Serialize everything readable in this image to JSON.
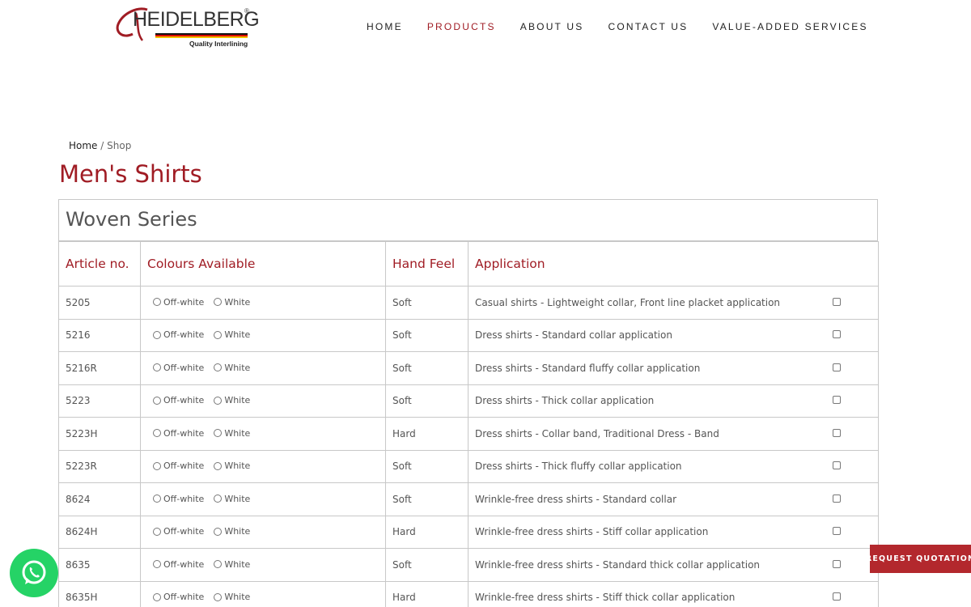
{
  "header": {
    "logo": {
      "name": "HEIDELBERG",
      "tagline": "Quality Interlining"
    },
    "nav": [
      {
        "label": "HOME"
      },
      {
        "label": "PRODUCTS"
      },
      {
        "label": "ABOUT US"
      },
      {
        "label": "CONTACT US"
      },
      {
        "label": "VALUE-ADDED SERVICES"
      }
    ],
    "active_nav": "PRODUCTS"
  },
  "breadcrumb": {
    "home": "Home",
    "separator": "/",
    "current": "Shop"
  },
  "page_title": "Men's Shirts",
  "series_title": "Woven Series",
  "table": {
    "columns": [
      "Article no.",
      "Colours Available",
      "Hand Feel",
      "Application"
    ],
    "colour_options": [
      "Off-white",
      "White"
    ],
    "rows": [
      {
        "article": "5205",
        "hand_feel": "Soft",
        "application": "Casual shirts - Lightweight collar, Front line placket application"
      },
      {
        "article": "5216",
        "hand_feel": "Soft",
        "application": "Dress shirts - Standard collar application"
      },
      {
        "article": "5216R",
        "hand_feel": "Soft",
        "application": "Dress shirts - Standard fluffy collar application"
      },
      {
        "article": "5223",
        "hand_feel": "Soft",
        "application": "Dress shirts - Thick collar application"
      },
      {
        "article": "5223H",
        "hand_feel": "Hard",
        "application": "Dress shirts - Collar band, Traditional Dress - Band"
      },
      {
        "article": "5223R",
        "hand_feel": "Soft",
        "application": "Dress shirts - Thick fluffy collar application"
      },
      {
        "article": "8624",
        "hand_feel": "Soft",
        "application": "Wrinkle-free dress shirts - Standard collar"
      },
      {
        "article": "8624H",
        "hand_feel": "Hard",
        "application": "Wrinkle-free dress shirts - Stiff collar application"
      },
      {
        "article": "8635",
        "hand_feel": "Soft",
        "application": "Wrinkle-free dress shirts - Standard thick collar application"
      },
      {
        "article": "8635H",
        "hand_feel": "Hard",
        "application": "Wrinkle-free dress shirts - Stiff thick collar application"
      }
    ]
  },
  "floating": {
    "whatsapp_icon": "whatsapp-icon",
    "request_quotation": "REQUEST QUOTATION"
  },
  "colors": {
    "brand_red": "#a01c24",
    "button_red": "#b3282d",
    "whatsapp_green": "#25d366"
  }
}
